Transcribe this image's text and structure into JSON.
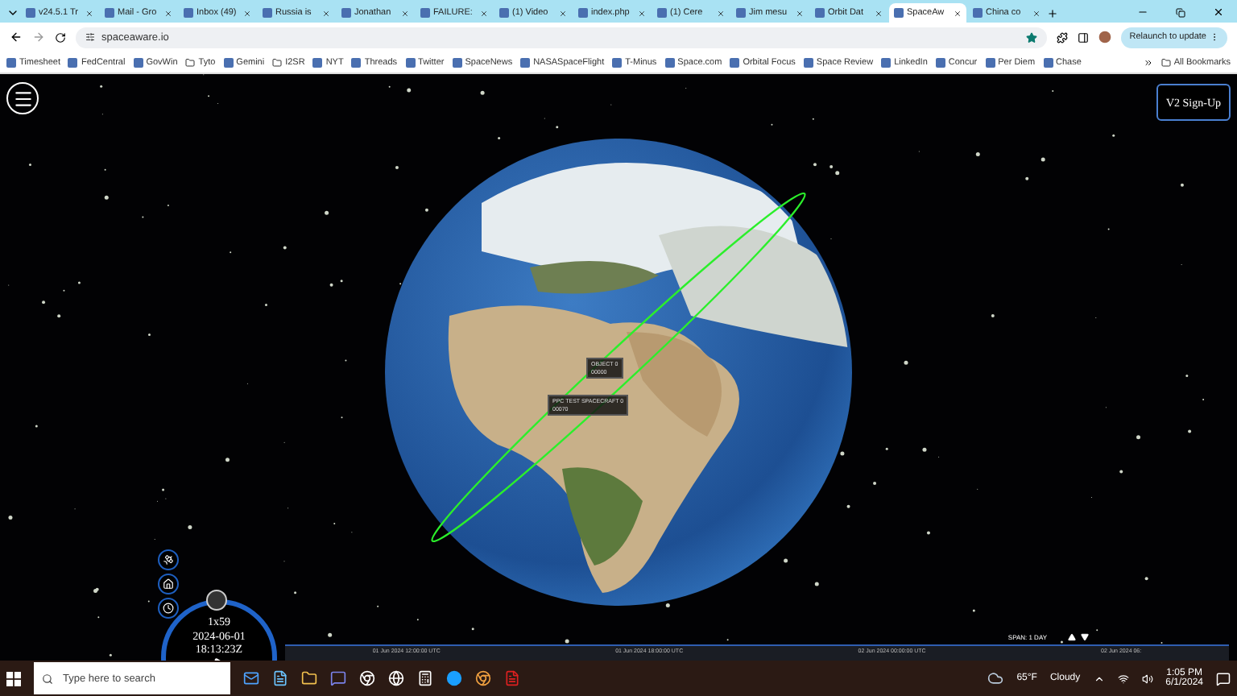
{
  "browser": {
    "tabs": [
      {
        "label": "v24.5.1 Tr",
        "selected": false
      },
      {
        "label": "Mail - Gro",
        "selected": false
      },
      {
        "label": "Inbox (49)",
        "selected": false
      },
      {
        "label": "Russia is",
        "selected": false
      },
      {
        "label": "Jonathan",
        "selected": false
      },
      {
        "label": "FAILURE:",
        "selected": false
      },
      {
        "label": "(1) Video",
        "selected": false
      },
      {
        "label": "index.php",
        "selected": false
      },
      {
        "label": "(1) Cere",
        "selected": false
      },
      {
        "label": "Jim mesu",
        "selected": false
      },
      {
        "label": "Orbit Dat",
        "selected": false
      },
      {
        "label": "SpaceAw",
        "selected": true
      },
      {
        "label": "China co",
        "selected": false
      }
    ],
    "address": "spaceaware.io",
    "relaunch_button": "Relaunch to update",
    "bookmarks": [
      {
        "label": "Timesheet",
        "kind": "site"
      },
      {
        "label": "FedCentral",
        "kind": "site"
      },
      {
        "label": "GovWin",
        "kind": "site"
      },
      {
        "label": "Tyto",
        "kind": "folder"
      },
      {
        "label": "Gemini",
        "kind": "site"
      },
      {
        "label": "I2SR",
        "kind": "folder"
      },
      {
        "label": "NYT",
        "kind": "site"
      },
      {
        "label": "Threads",
        "kind": "site"
      },
      {
        "label": "Twitter",
        "kind": "site"
      },
      {
        "label": "SpaceNews",
        "kind": "site"
      },
      {
        "label": "NASASpaceFlight",
        "kind": "site"
      },
      {
        "label": "T-Minus",
        "kind": "site"
      },
      {
        "label": "Space.com",
        "kind": "site"
      },
      {
        "label": "Orbital Focus",
        "kind": "site"
      },
      {
        "label": "Space Review",
        "kind": "site"
      },
      {
        "label": "LinkedIn",
        "kind": "site"
      },
      {
        "label": "Concur",
        "kind": "site"
      },
      {
        "label": "Per Diem",
        "kind": "site"
      },
      {
        "label": "Chase",
        "kind": "site"
      }
    ],
    "all_bookmarks": "All Bookmarks"
  },
  "app": {
    "signup_button": "V2 Sign-Up",
    "labels": [
      {
        "title": "OBJECT 0",
        "id": "00000"
      },
      {
        "title": "PPC TEST SPACECRAFT 0",
        "id": "00070"
      }
    ],
    "clock": {
      "speed": "1x59",
      "date": "2024-06-01",
      "time": "18:13:23Z"
    },
    "timeline": {
      "span": "SPAN: 1 DAY",
      "ticks": [
        "01 Jun 2024 12:00:00 UTC",
        "01 Jun 2024 18:00:00 UTC",
        "02 Jun 2024 00:00:00 UTC",
        "02 Jun 2024 06:"
      ]
    }
  },
  "taskbar": {
    "search": {
      "placeholder": "Type here to search"
    },
    "temperature": "65°F",
    "condition": "Cloudy",
    "time": "1:05 PM",
    "date": "6/1/2024"
  }
}
